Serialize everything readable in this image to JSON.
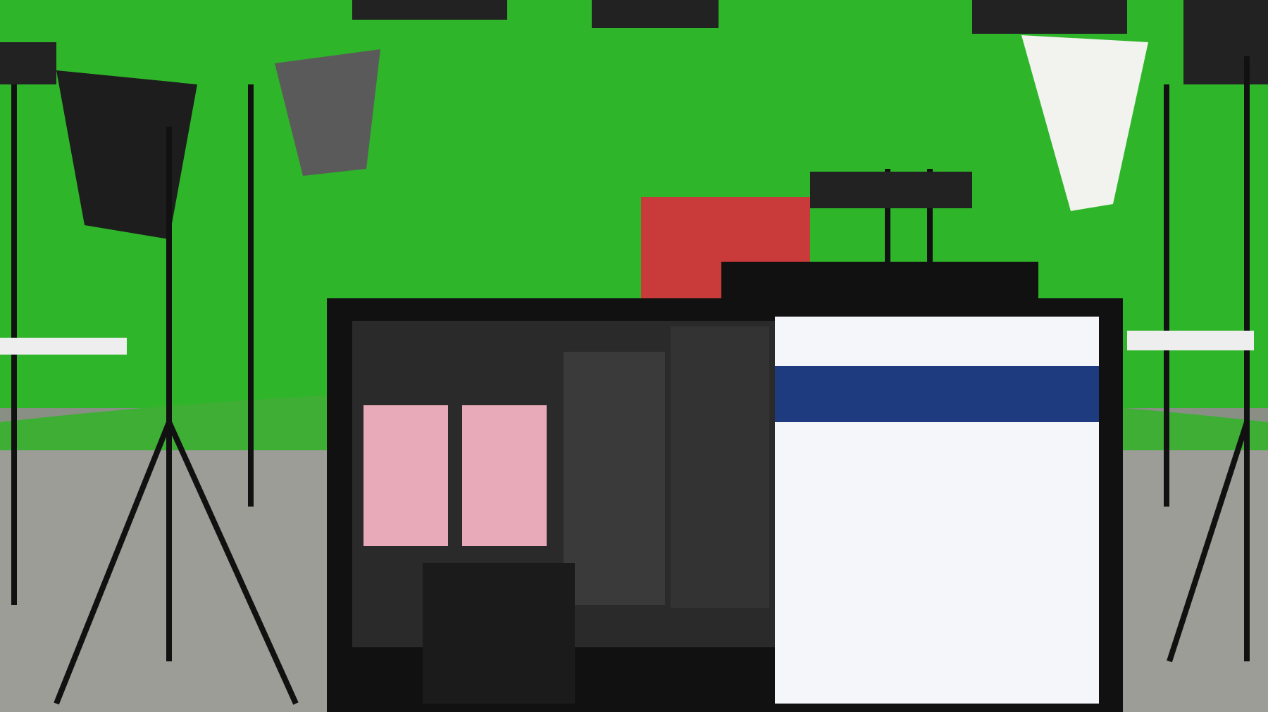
{
  "photo": {
    "kind": "studio-scene"
  }
}
